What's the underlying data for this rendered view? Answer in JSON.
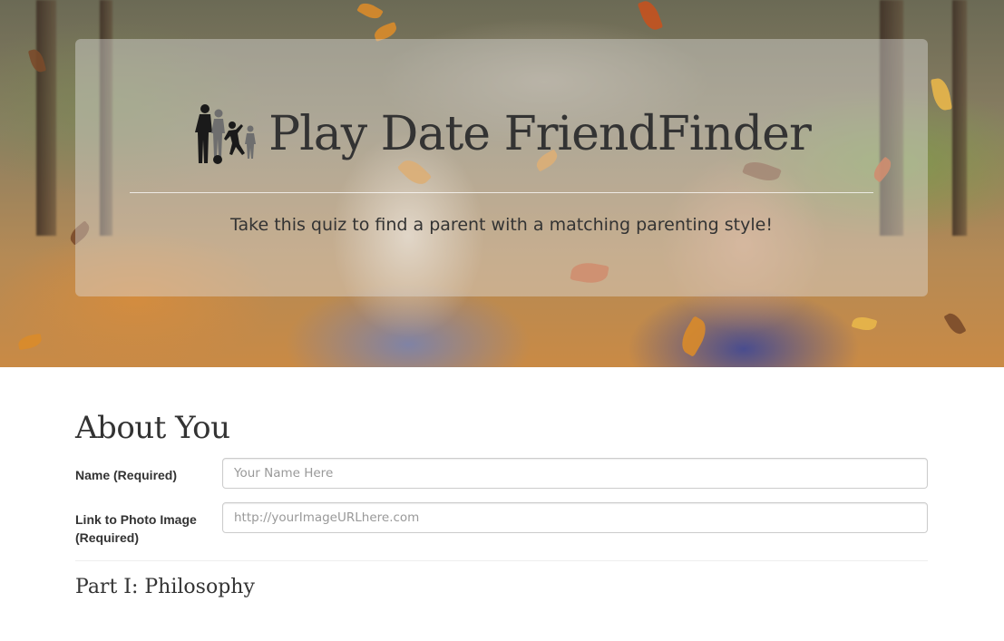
{
  "header": {
    "logo_icon": "family-silhouette-icon",
    "title": "Play Date FriendFinder",
    "tagline": "Take this quiz to find a parent with a matching parenting style!"
  },
  "about": {
    "title": "About You",
    "name_label": "Name (Required)",
    "name_placeholder": "Your Name Here",
    "name_value": "",
    "photo_label": "Link to Photo Image (Required)",
    "photo_placeholder": "http://yourImageURLhere.com",
    "photo_value": ""
  },
  "part1": {
    "title": "Part I: Philosophy"
  },
  "colors": {
    "text": "#333333",
    "input_border": "#cccccc",
    "placeholder": "#999999",
    "jumbotron_overlay": "rgba(225,225,225,0.42)"
  }
}
